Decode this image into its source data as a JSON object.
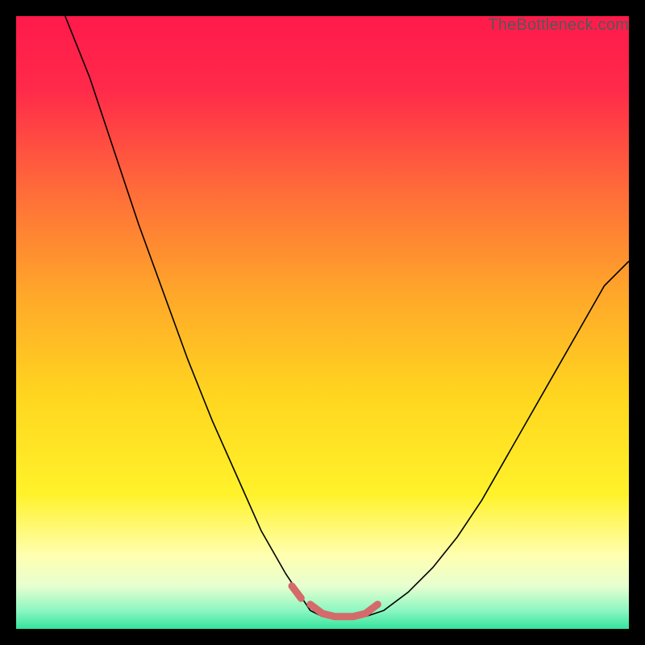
{
  "watermark": {
    "text": "TheBottleneck.com"
  },
  "chart_data": {
    "type": "line",
    "title": "",
    "xlabel": "",
    "ylabel": "",
    "xlim": [
      0,
      100
    ],
    "ylim": [
      0,
      100
    ],
    "background_gradient_stops": [
      {
        "offset": 0.0,
        "color": "#ff1a4b"
      },
      {
        "offset": 0.12,
        "color": "#ff2a4a"
      },
      {
        "offset": 0.28,
        "color": "#ff6a3a"
      },
      {
        "offset": 0.45,
        "color": "#ffa62a"
      },
      {
        "offset": 0.62,
        "color": "#ffd61f"
      },
      {
        "offset": 0.78,
        "color": "#fff22a"
      },
      {
        "offset": 0.88,
        "color": "#ffffb0"
      },
      {
        "offset": 0.93,
        "color": "#e7ffd0"
      },
      {
        "offset": 0.97,
        "color": "#8cf7c2"
      },
      {
        "offset": 1.0,
        "color": "#35e39e"
      }
    ],
    "series": [
      {
        "name": "left-curve",
        "stroke": "#000000",
        "stroke_width": 1.6,
        "x": [
          8,
          12,
          16,
          20,
          24,
          28,
          32,
          36,
          40,
          44,
          48,
          50
        ],
        "y": [
          100,
          90,
          78,
          66,
          55,
          44,
          34,
          25,
          16,
          9,
          3,
          2
        ]
      },
      {
        "name": "right-curve",
        "stroke": "#000000",
        "stroke_width": 1.6,
        "x": [
          57,
          60,
          64,
          68,
          72,
          76,
          80,
          84,
          88,
          92,
          96,
          100
        ],
        "y": [
          2,
          3,
          6,
          10,
          15,
          21,
          28,
          35,
          42,
          49,
          56,
          60
        ]
      },
      {
        "name": "bottom-bar",
        "stroke": "#d46a6a",
        "stroke_width": 9,
        "linecap": "round",
        "x": [
          48,
          50,
          52,
          55,
          57,
          59
        ],
        "y": [
          4,
          2.5,
          2,
          2,
          2.5,
          4
        ]
      },
      {
        "name": "left-nub",
        "stroke": "#d46a6a",
        "stroke_width": 9,
        "linecap": "round",
        "x": [
          45,
          46.5
        ],
        "y": [
          7,
          5
        ]
      }
    ]
  }
}
